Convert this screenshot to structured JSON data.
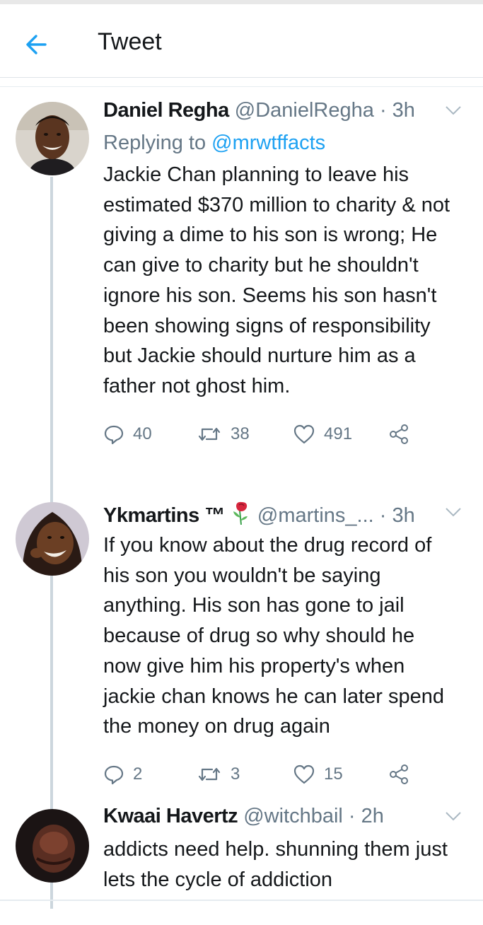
{
  "header": {
    "title": "Tweet"
  },
  "tweets": [
    {
      "name": "Daniel Regha",
      "handle": "@DanielRegha",
      "dot": " · ",
      "time": "3h",
      "replying_prefix": "Replying to ",
      "replying_to": "@mrwtffacts",
      "text": "Jackie Chan planning to leave his estimated $370 million to charity & not giving a dime to his son is wrong; He can give to charity but he shouldn't ignore his son. Seems his son hasn't been showing signs of responsibility but Jackie should nurture him as a father not ghost him.",
      "replies": "40",
      "retweets": "38",
      "likes": "491"
    },
    {
      "name": "Ykmartins ™",
      "handle": "@martins_...",
      "dot": " · ",
      "time": "3h",
      "text": "If you know about the drug record of his son you wouldn't be saying anything. His son has gone to jail because of drug so why should he now give him his property's when jackie chan knows he can later spend the money on drug again",
      "replies": "2",
      "retweets": "3",
      "likes": "15"
    },
    {
      "name": "Kwaai Havertz",
      "handle": "@witchbail",
      "dot": " · ",
      "time": "2h",
      "text": "addicts need help. shunning them just lets the cycle of addiction"
    }
  ],
  "colors": {
    "accent": "#1da1f2",
    "secondary_text": "#657786",
    "thread_line": "#ccd6dd"
  },
  "icons": [
    "back-arrow-icon",
    "chevron-down-icon",
    "reply-icon",
    "retweet-icon",
    "like-icon",
    "share-icon",
    "rose-emoji-icon"
  ]
}
